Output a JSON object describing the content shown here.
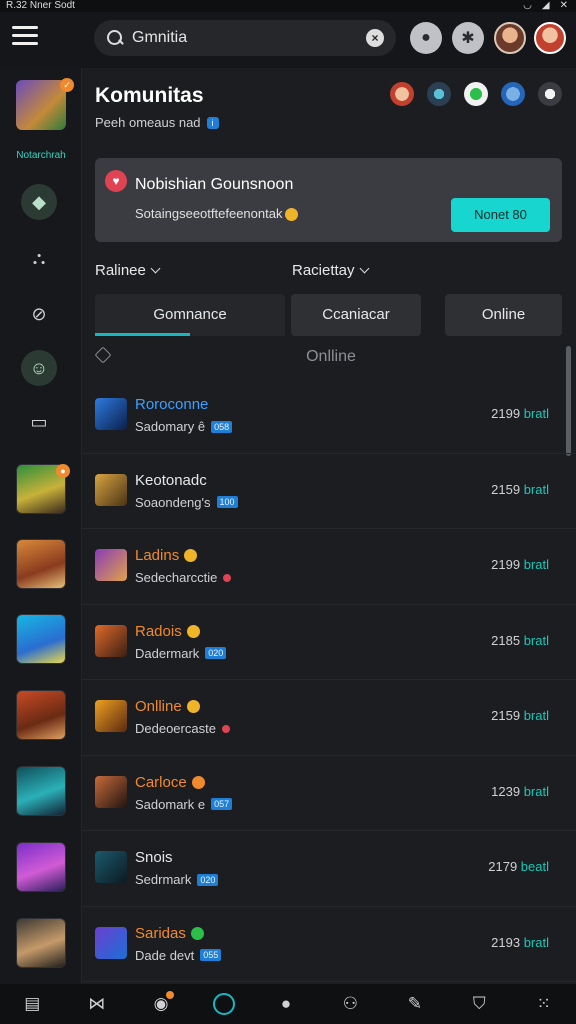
{
  "status_bar": {
    "text": "R.32 Nner Sodt"
  },
  "topbar": {
    "search": {
      "value": "Gmnitia"
    }
  },
  "rail": {
    "label": "Notarchrah"
  },
  "main": {
    "title": "Komunitas",
    "subtitle": "Peeh omeaus nad",
    "notice": {
      "title": "Nobishian Gounsnoon",
      "body": "Sotaingseeotftefeenontak",
      "button": "Nonet 80"
    },
    "filters": [
      {
        "label": "Ralinee"
      },
      {
        "label": "Raciettay"
      }
    ],
    "tabs": [
      {
        "label": "Gomnance"
      },
      {
        "label": "Ccaniacar"
      },
      {
        "label": "Online"
      }
    ],
    "list_header": "Onlline",
    "rows": [
      {
        "name": "Roroconne",
        "name_color": "#3aa0ff",
        "sub": "Sadomary ê",
        "tag": "058",
        "count": "2199",
        "status": "bratl"
      },
      {
        "name": "Keotonadc",
        "name_color": "#e8e8ea",
        "sub": "Soaondeng's",
        "tag": "100",
        "count": "2159",
        "status": "bratl"
      },
      {
        "name": "Ladins",
        "name_color": "#f08a2c",
        "sub": "Sedecharcctie",
        "tag": "",
        "count": "2199",
        "status": "bratl"
      },
      {
        "name": "Radois",
        "name_color": "#f08a2c",
        "sub": "Dadermark",
        "tag": "020",
        "count": "2185",
        "status": "bratl"
      },
      {
        "name": "Onlline",
        "name_color": "#f08a2c",
        "sub": "Dedeoercaste",
        "tag": "",
        "count": "2159",
        "status": "bratl"
      },
      {
        "name": "Carloce",
        "name_color": "#f08a2c",
        "sub": "Sadomark e",
        "tag": "057",
        "count": "1239",
        "status": "bratl"
      },
      {
        "name": "Snois",
        "name_color": "#e8e8ea",
        "sub": "Sedrmark",
        "tag": "020",
        "count": "2179",
        "status": "beatl"
      },
      {
        "name": "Saridas",
        "name_color": "#f08a2c",
        "sub": "Dade devt",
        "tag": "055",
        "count": "2193",
        "status": "bratl"
      }
    ]
  },
  "colors": {
    "accent": "#17d6cf",
    "orange": "#f08a2c",
    "blue": "#3aa0ff",
    "danger": "#e04352"
  }
}
